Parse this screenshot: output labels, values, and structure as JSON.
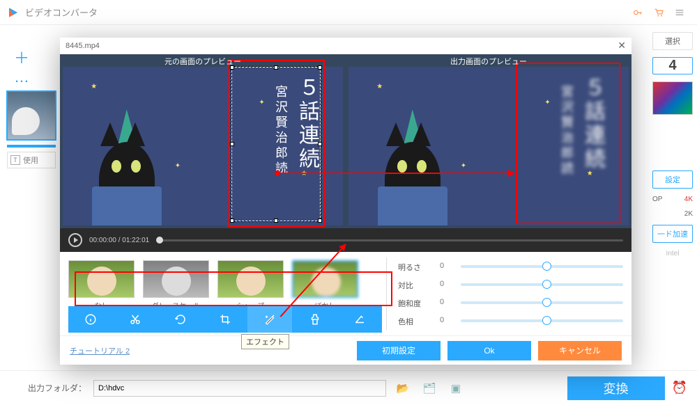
{
  "app": {
    "title": "ビデオコンバータ"
  },
  "left": {
    "use_label": "使用"
  },
  "right": {
    "select": "選択",
    "format_4": "4",
    "settings": "設定",
    "res_op": "OP",
    "res_4k": "4K",
    "res_2k": "2K",
    "accel": "一ド加速",
    "intel": "Intel"
  },
  "footer": {
    "label": "出力フォルダ：",
    "path": "D:\\hdvc",
    "convert": "変換"
  },
  "modal": {
    "filename": "8445.mp4",
    "preview_src": "元の画面のプレビュー",
    "preview_out": "出力画面のプレビュー",
    "vtext_main": "５話連続",
    "vtext_sub": "宮沢賢治郎読",
    "time_cur": "00:00:00",
    "time_dur": "01:22:01",
    "thumbs": {
      "none": "なし",
      "gray": "グレースケール",
      "sharp": "シャープ",
      "blur": "ぼかし"
    },
    "sliders": {
      "brightness": {
        "label": "明るさ",
        "value": "0"
      },
      "contrast": {
        "label": "対比",
        "value": "0"
      },
      "saturation": {
        "label": "飽和度",
        "value": "0"
      },
      "hue": {
        "label": "色相",
        "value": "0"
      }
    },
    "effect_tooltip": "エフェクト",
    "tutorial": "チュートリアル 2",
    "btn_reset": "初期設定",
    "btn_ok": "Ok",
    "btn_cancel": "キャンセル"
  }
}
